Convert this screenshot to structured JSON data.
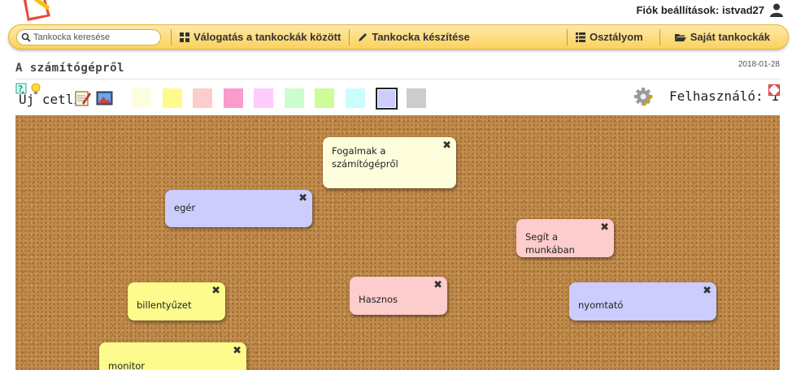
{
  "account": {
    "label": "Fiók beállítások: istvad27"
  },
  "nav": {
    "search_placeholder": "Tankocka keresése",
    "items": [
      {
        "label": "Válogatás a tankockák között",
        "icon": "grid-icon"
      },
      {
        "label": "Tankocka készítése",
        "icon": "pencil-icon"
      },
      {
        "label": "Osztályom",
        "icon": "list-icon"
      },
      {
        "label": "Saját tankockák",
        "icon": "folder-icon"
      }
    ]
  },
  "page": {
    "title": "A számítógépről",
    "date": "2018-01-28"
  },
  "toolbar": {
    "new_label": "Új cetli:",
    "user_label": "Felhasználó: 1",
    "swatches": [
      "#fdfde0",
      "#fdfb8c",
      "#fdcccc",
      "#f99ccc",
      "#fdccfd",
      "#ccfdcc",
      "#ccfd99",
      "#ccfdfd",
      "#ccccfd",
      "#cccccc"
    ],
    "selected_swatch": 8
  },
  "notes": [
    {
      "text": "Fogalmak a számítógépről",
      "color": "#fefddc"
    },
    {
      "text": "egér",
      "color": "#ccccfd"
    },
    {
      "text": "Segít a munkában",
      "color": "#fdcccc"
    },
    {
      "text": "billentyűzet",
      "color": "#fdfb8c"
    },
    {
      "text": "Hasznos",
      "color": "#fdcccc"
    },
    {
      "text": "nyomtató",
      "color": "#ccccfd"
    },
    {
      "text": "monitor",
      "color": "#fdfb8c"
    }
  ],
  "close_glyph": "✖"
}
